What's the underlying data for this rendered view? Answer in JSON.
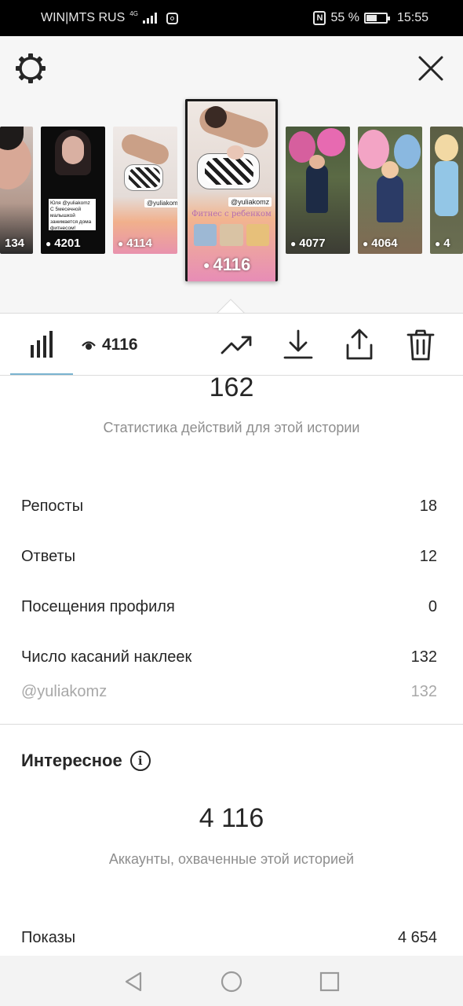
{
  "status_bar": {
    "carrier": "WIN|MTS RUS",
    "network": "4G",
    "battery": "55 %",
    "battery_level": 0.55,
    "time": "15:55"
  },
  "thumbnails": [
    {
      "views": "134"
    },
    {
      "views": "4201",
      "caption": "Юля @yuliakomz С 5месечной малышкой занимается дома фитнесом!"
    },
    {
      "views": "4114",
      "tag": "@yuliakomz"
    },
    {
      "views": "4116",
      "tag": "@yuliakomz",
      "caption": "Фитнес с ребенком",
      "selected": true
    },
    {
      "views": "4077"
    },
    {
      "views": "4064"
    },
    {
      "views": "4"
    }
  ],
  "tabbar": {
    "views": "4116"
  },
  "interactions": {
    "total": "162",
    "subtitle": "Статистика действий для этой истории",
    "rows": [
      {
        "label": "Репосты",
        "value": "18"
      },
      {
        "label": "Ответы",
        "value": "12"
      },
      {
        "label": "Посещения профиля",
        "value": "0"
      },
      {
        "label": "Число касаний наклеек",
        "value": "132"
      },
      {
        "label": "@yuliakomz",
        "value": "132"
      }
    ]
  },
  "discovery": {
    "title": "Интересное",
    "reach": "4 116",
    "subtitle": "Аккаунты, охваченные этой историей",
    "rows": [
      {
        "label": "Показы",
        "value": "4 654"
      }
    ]
  }
}
